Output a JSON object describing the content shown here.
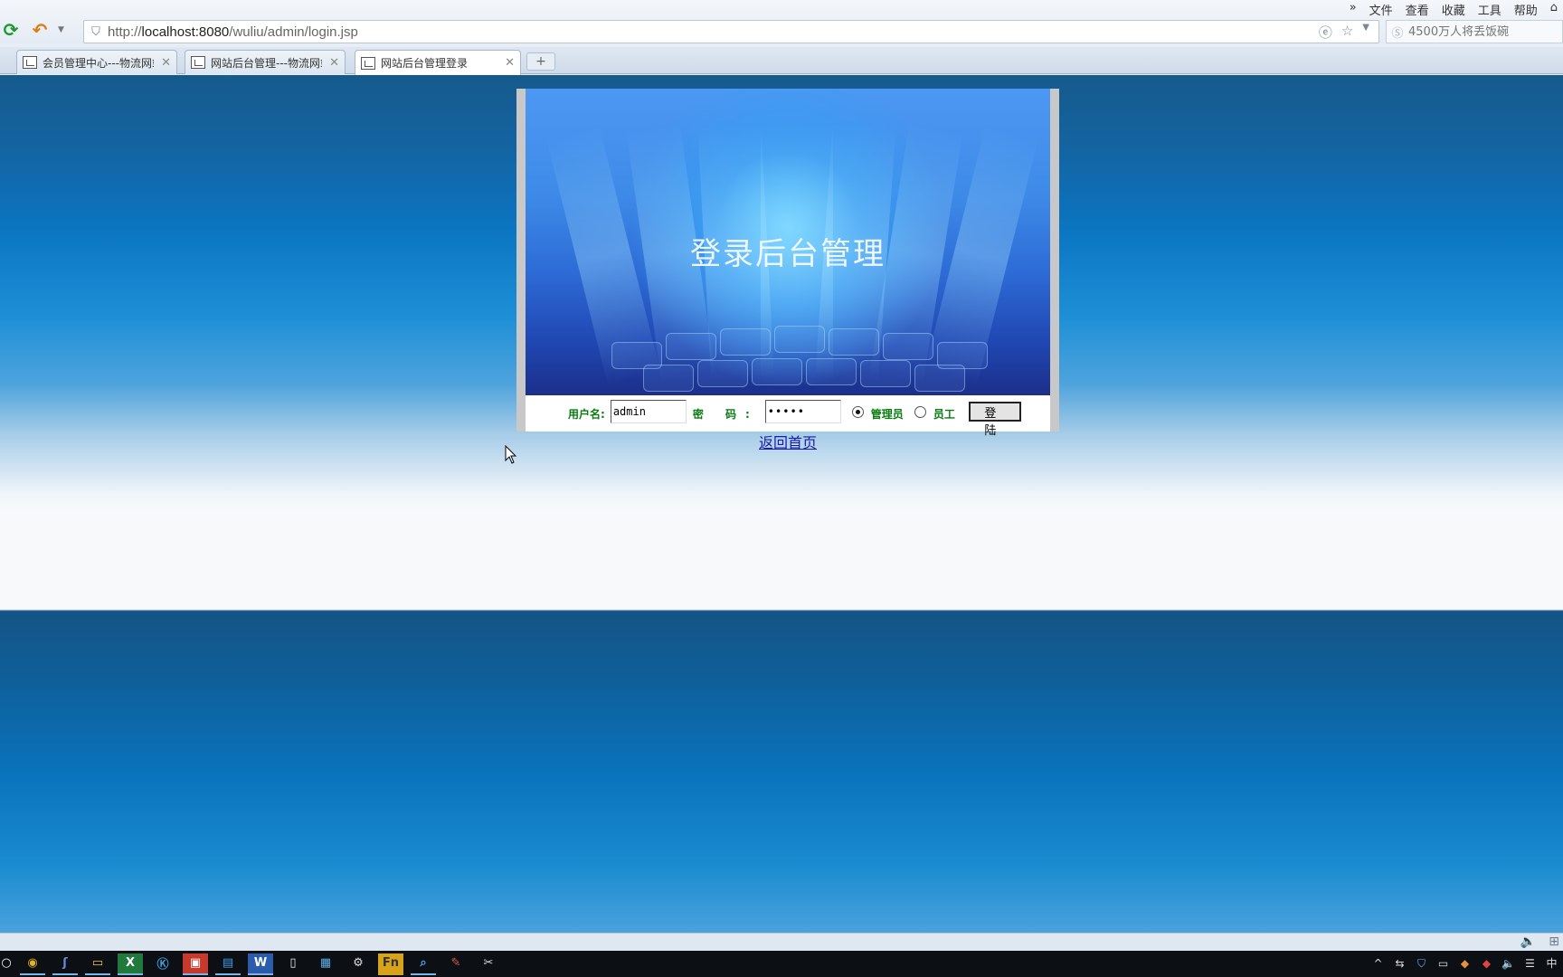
{
  "browser": {
    "menu": [
      "»",
      "文件",
      "查看",
      "收藏",
      "工具",
      "帮助"
    ],
    "url_prefix": "http://",
    "url_host": "localhost:8080",
    "url_path": "/wuliu/admin/login.jsp",
    "search_placeholder": "4500万人将丢饭碗",
    "tabs": [
      {
        "label": "会员管理中心---物流网站",
        "active": false
      },
      {
        "label": "网站后台管理---物流网站",
        "active": false
      },
      {
        "label": "网站后台管理登录",
        "active": true
      }
    ],
    "new_tab_label": "+"
  },
  "login": {
    "banner_title": "登录后台管理",
    "username_label": "用户名:",
    "username_value": "admin",
    "password_label": "密 码:",
    "password_value": "•••••",
    "role_admin_label": "管理员",
    "role_staff_label": "员工",
    "selected_role": "管理员",
    "login_button_label": "登 陆",
    "back_link_label": "返回首页"
  },
  "taskbar": {
    "apps": [
      "cortana-icon",
      "chrome-icon",
      "eclipse-icon",
      "explorer-icon",
      "excel-icon",
      "k-icon",
      "app-red-icon",
      "app-blue-icon",
      "word-icon",
      "app-doc-icon",
      "app-window-icon",
      "settings-icon",
      "app-yellow-icon",
      "search-app-icon",
      "app-pencil-icon",
      "app-tool-icon"
    ],
    "ime_label": "中"
  }
}
